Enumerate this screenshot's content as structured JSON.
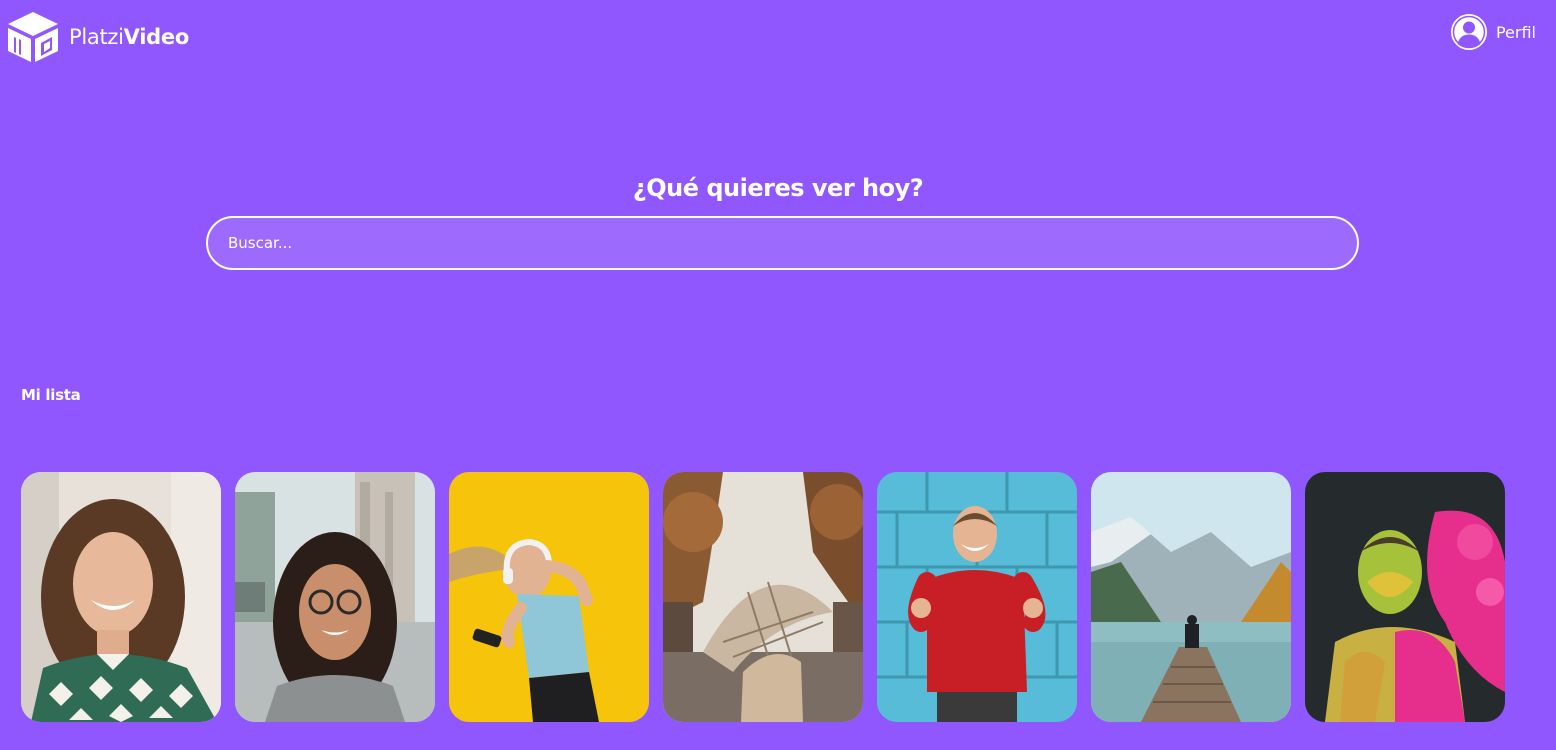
{
  "header": {
    "logo": {
      "light_text": "Platzi",
      "bold_text": "Video",
      "icon": "cube-logo-icon"
    },
    "profile": {
      "label": "Perfil",
      "icon": "user-avatar-icon"
    }
  },
  "search": {
    "title": "¿Qué quieres ver hoy?",
    "placeholder": "Buscar..."
  },
  "my_list": {
    "title": "Mi lista",
    "items": [
      {
        "thumbnail": "woman-curly-hair-smiling-photo"
      },
      {
        "thumbnail": "woman-glasses-street-photo"
      },
      {
        "thumbnail": "woman-headphones-yellow-background-photo"
      },
      {
        "thumbnail": "person-umbrella-autumn-street-photo"
      },
      {
        "thumbnail": "man-red-sweater-celebrating-photo"
      },
      {
        "thumbnail": "person-on-pier-mountain-lake-photo"
      },
      {
        "thumbnail": "man-colored-powder-photo"
      }
    ]
  },
  "colors": {
    "background": "#8f57fd",
    "text": "#ffffff"
  }
}
